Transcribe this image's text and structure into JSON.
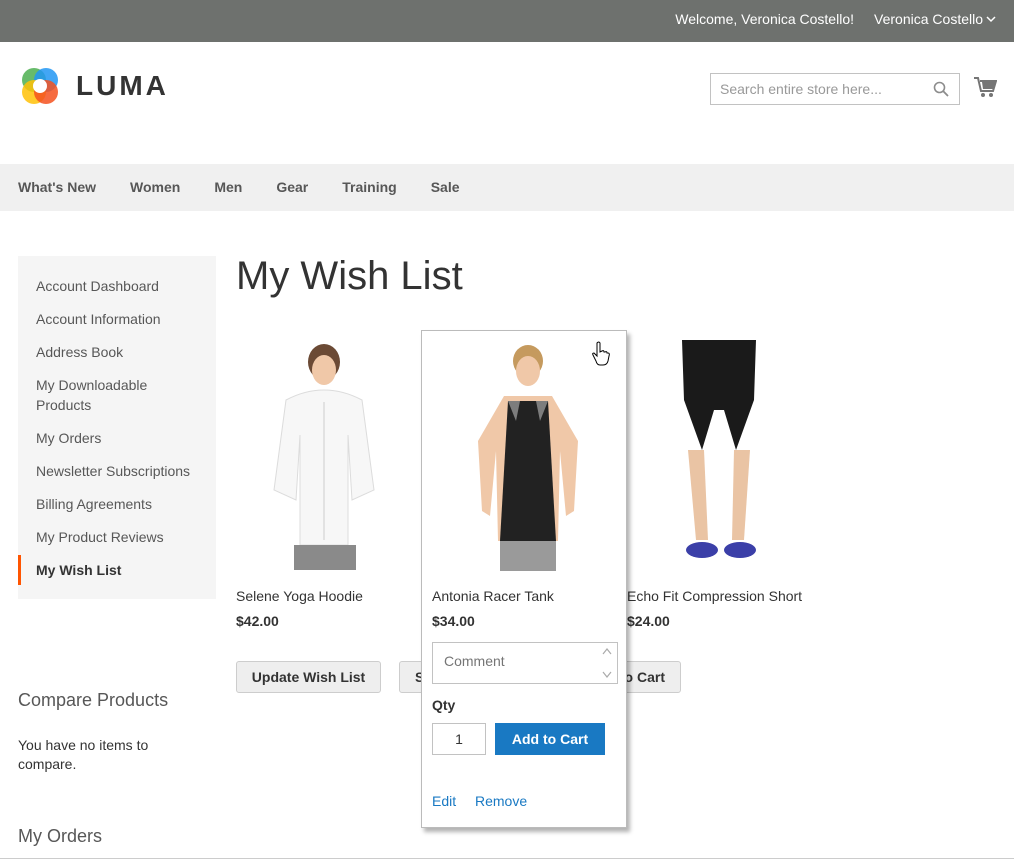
{
  "topbar": {
    "welcome": "Welcome, Veronica Costello!",
    "account_name": "Veronica Costello"
  },
  "header": {
    "logo_text": "LUMA",
    "search_placeholder": "Search entire store here..."
  },
  "nav": {
    "items": [
      "What's New",
      "Women",
      "Men",
      "Gear",
      "Training",
      "Sale"
    ]
  },
  "sidebar": {
    "items": [
      {
        "label": "Account Dashboard"
      },
      {
        "label": "Account Information"
      },
      {
        "label": "Address Book"
      },
      {
        "label": "My Downloadable Products"
      },
      {
        "label": "My Orders"
      },
      {
        "label": "Newsletter Subscriptions"
      },
      {
        "label": "Billing Agreements"
      },
      {
        "label": "My Product Reviews"
      },
      {
        "label": "My Wish List",
        "active": true
      }
    ]
  },
  "compare": {
    "title": "Compare Products",
    "text": "You have no items to compare."
  },
  "my_orders_title": "My Orders",
  "page_title": "My Wish List",
  "products": [
    {
      "name": "Selene Yoga Hoodie",
      "price": "$42.00"
    },
    {
      "name": "Antonia Racer Tank",
      "price": "$34.00"
    },
    {
      "name": "Echo Fit Compression Short",
      "price": "$24.00"
    }
  ],
  "actions": {
    "update_label": "Update Wish List",
    "share_label_partial": "S",
    "add_all_partial": "o Cart"
  },
  "hover_card": {
    "comment_placeholder": "Comment",
    "qty_label": "Qty",
    "qty_value": "1",
    "add_to_cart_label": "Add to Cart",
    "edit_label": "Edit",
    "remove_label": "Remove"
  },
  "colors": {
    "topbar": "#6e716e",
    "primary": "#1979c3",
    "active_marker": "#ff5501",
    "nav_bg": "#f0f0f0"
  }
}
